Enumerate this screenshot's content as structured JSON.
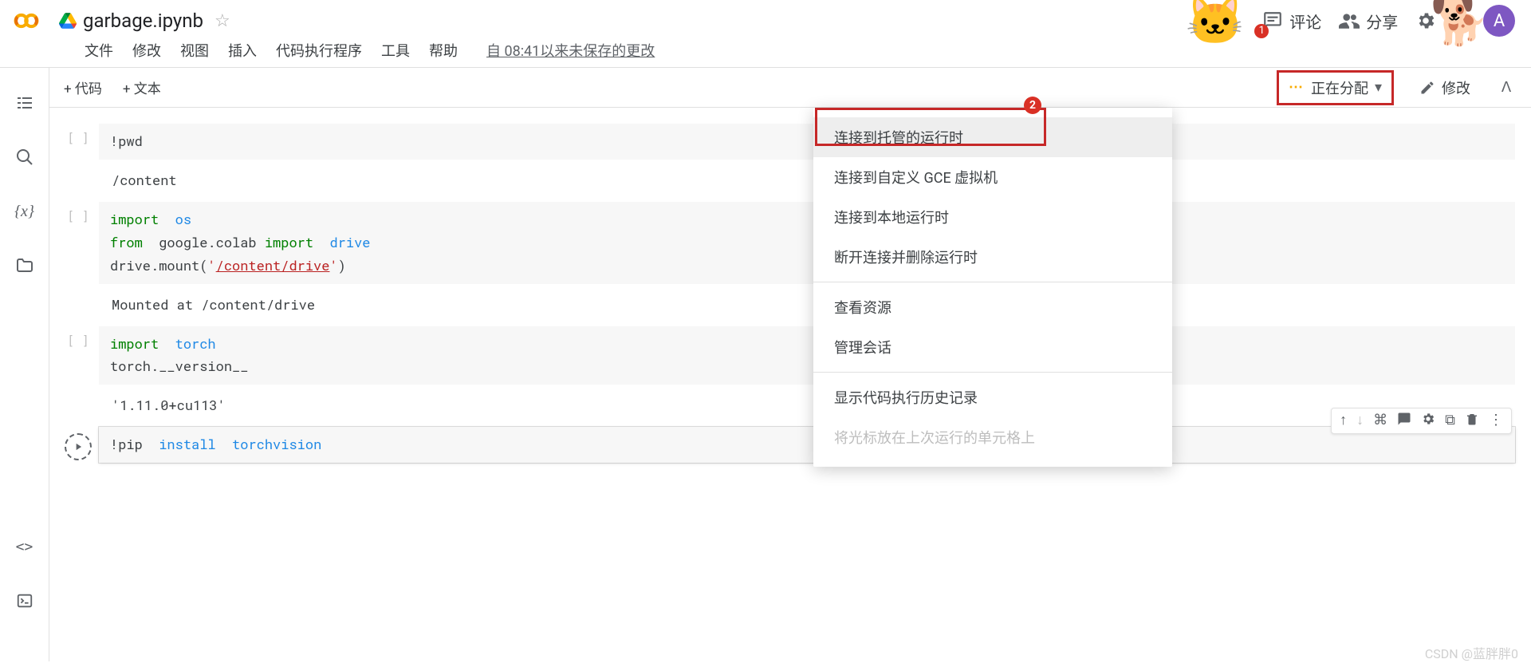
{
  "header": {
    "title": "garbage.ipynb",
    "comment_label": "评论",
    "share_label": "分享",
    "avatar_initial": "A"
  },
  "menu": {
    "file": "文件",
    "edit": "修改",
    "view": "视图",
    "insert": "插入",
    "runtime": "代码执行程序",
    "tools": "工具",
    "help": "帮助",
    "last_save": "自 08:41以来未保存的更改"
  },
  "toolbar": {
    "add_code": "+ 代码",
    "add_text": "+ 文本",
    "connect_status": "正在分配",
    "edit_label": "修改"
  },
  "dropdown": {
    "items": [
      "连接到托管的运行时",
      "连接到自定义 GCE 虚拟机",
      "连接到本地运行时",
      "断开连接并删除运行时"
    ],
    "group2": [
      "查看资源",
      "管理会话"
    ],
    "group3": [
      "显示代码执行历史记录"
    ],
    "disabled_item": "将光标放在上次运行的单元格上"
  },
  "annotations": {
    "circle1": "1",
    "circle2": "2"
  },
  "cells": {
    "c1": {
      "code_plain": "!pwd",
      "output": "/content"
    },
    "c2": {
      "line1_kw": "import",
      "line1_ident": "os",
      "line2_kw1": "from",
      "line2_mod": "google.colab",
      "line2_kw2": "import",
      "line2_ident": "drive",
      "line3_pre": "drive.mount(",
      "line3_str_q1": "'",
      "line3_str_path": "/content/drive",
      "line3_str_q2": "'",
      "line3_post": ")",
      "output": "Mounted at /content/drive"
    },
    "c3": {
      "line1_kw": "import",
      "line1_ident": "torch",
      "line2": "torch.__version__",
      "output": "'1.11.0+cu113'"
    },
    "c4": {
      "line1_pre": "!pip ",
      "line1_cmd": "install",
      "line1_pkg": "torchvision"
    }
  },
  "watermark": "CSDN @蓝胖胖0"
}
